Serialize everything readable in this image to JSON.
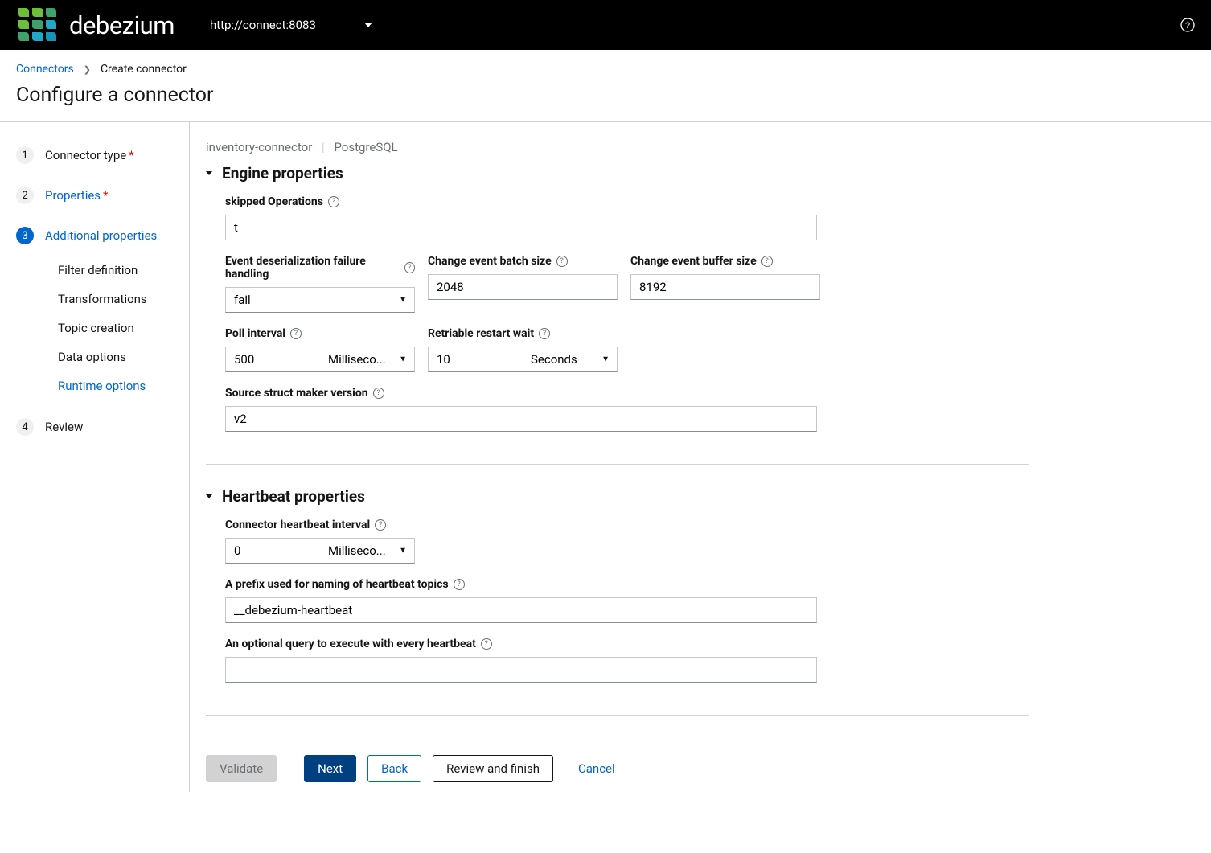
{
  "header": {
    "brand": "debezium",
    "cluster_url": "http://connect:8083"
  },
  "breadcrumb": {
    "link": "Connectors",
    "current": "Create connector"
  },
  "page_title": "Configure a connector",
  "wizard": {
    "steps": {
      "s1": {
        "num": "1",
        "label": "Connector type"
      },
      "s2": {
        "num": "2",
        "label": "Properties"
      },
      "s3": {
        "num": "3",
        "label": "Additional properties"
      },
      "s4": {
        "num": "4",
        "label": "Review"
      }
    },
    "substeps": {
      "a": "Filter definition",
      "b": "Transformations",
      "c": "Topic creation",
      "d": "Data options",
      "e": "Runtime options"
    }
  },
  "connector": {
    "name": "inventory-connector",
    "type": "PostgreSQL"
  },
  "sections": {
    "engine": {
      "title": "Engine properties",
      "fields": {
        "skipped_ops": {
          "label": "skipped Operations",
          "value": "t"
        },
        "deser_fail": {
          "label": "Event deserialization failure handling",
          "value": "fail"
        },
        "batch_size": {
          "label": "Change event batch size",
          "value": "2048"
        },
        "buffer_size": {
          "label": "Change event buffer size",
          "value": "8192"
        },
        "poll_interval": {
          "label": "Poll interval",
          "value": "500",
          "unit": "Milliseco..."
        },
        "retriable_wait": {
          "label": "Retriable restart wait",
          "value": "10",
          "unit": "Seconds"
        },
        "struct_ver": {
          "label": "Source struct maker version",
          "value": "v2"
        }
      }
    },
    "heartbeat": {
      "title": "Heartbeat properties",
      "fields": {
        "interval": {
          "label": "Connector heartbeat interval",
          "value": "0",
          "unit": "Milliseco..."
        },
        "prefix": {
          "label": "A prefix used for naming of heartbeat topics",
          "value": "__debezium-heartbeat"
        },
        "query": {
          "label": "An optional query to execute with every heartbeat",
          "value": ""
        }
      }
    }
  },
  "footer": {
    "validate": "Validate",
    "next": "Next",
    "back": "Back",
    "review": "Review and finish",
    "cancel": "Cancel"
  }
}
